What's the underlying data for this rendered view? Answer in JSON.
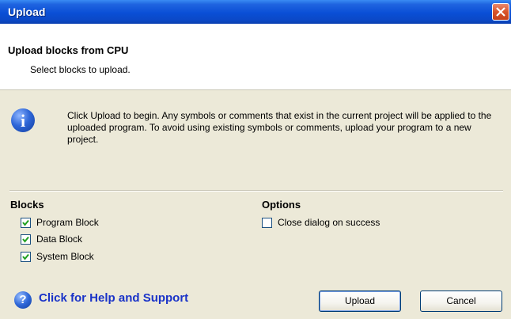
{
  "window": {
    "title": "Upload"
  },
  "header": {
    "title": "Upload blocks from CPU",
    "subtitle": "Select blocks to upload."
  },
  "info": {
    "icon": "info-icon",
    "text": "Click Upload to begin.  Any symbols or comments that exist in the current project will be applied to the uploaded program.  To avoid using existing symbols or comments, upload your program to a new project."
  },
  "blocks": {
    "label": "Blocks",
    "items": [
      {
        "label": "Program Block",
        "checked": true
      },
      {
        "label": "Data Block",
        "checked": true
      },
      {
        "label": "System Block",
        "checked": true
      }
    ]
  },
  "options": {
    "label": "Options",
    "items": [
      {
        "label": "Close dialog on success",
        "checked": false
      }
    ]
  },
  "footer": {
    "help_label": "Click for Help and Support",
    "upload_label": "Upload",
    "cancel_label": "Cancel"
  },
  "colors": {
    "titlebar": "#0a4fd6",
    "close": "#d9542a",
    "link": "#1a33c8",
    "face": "#ece9d8"
  }
}
